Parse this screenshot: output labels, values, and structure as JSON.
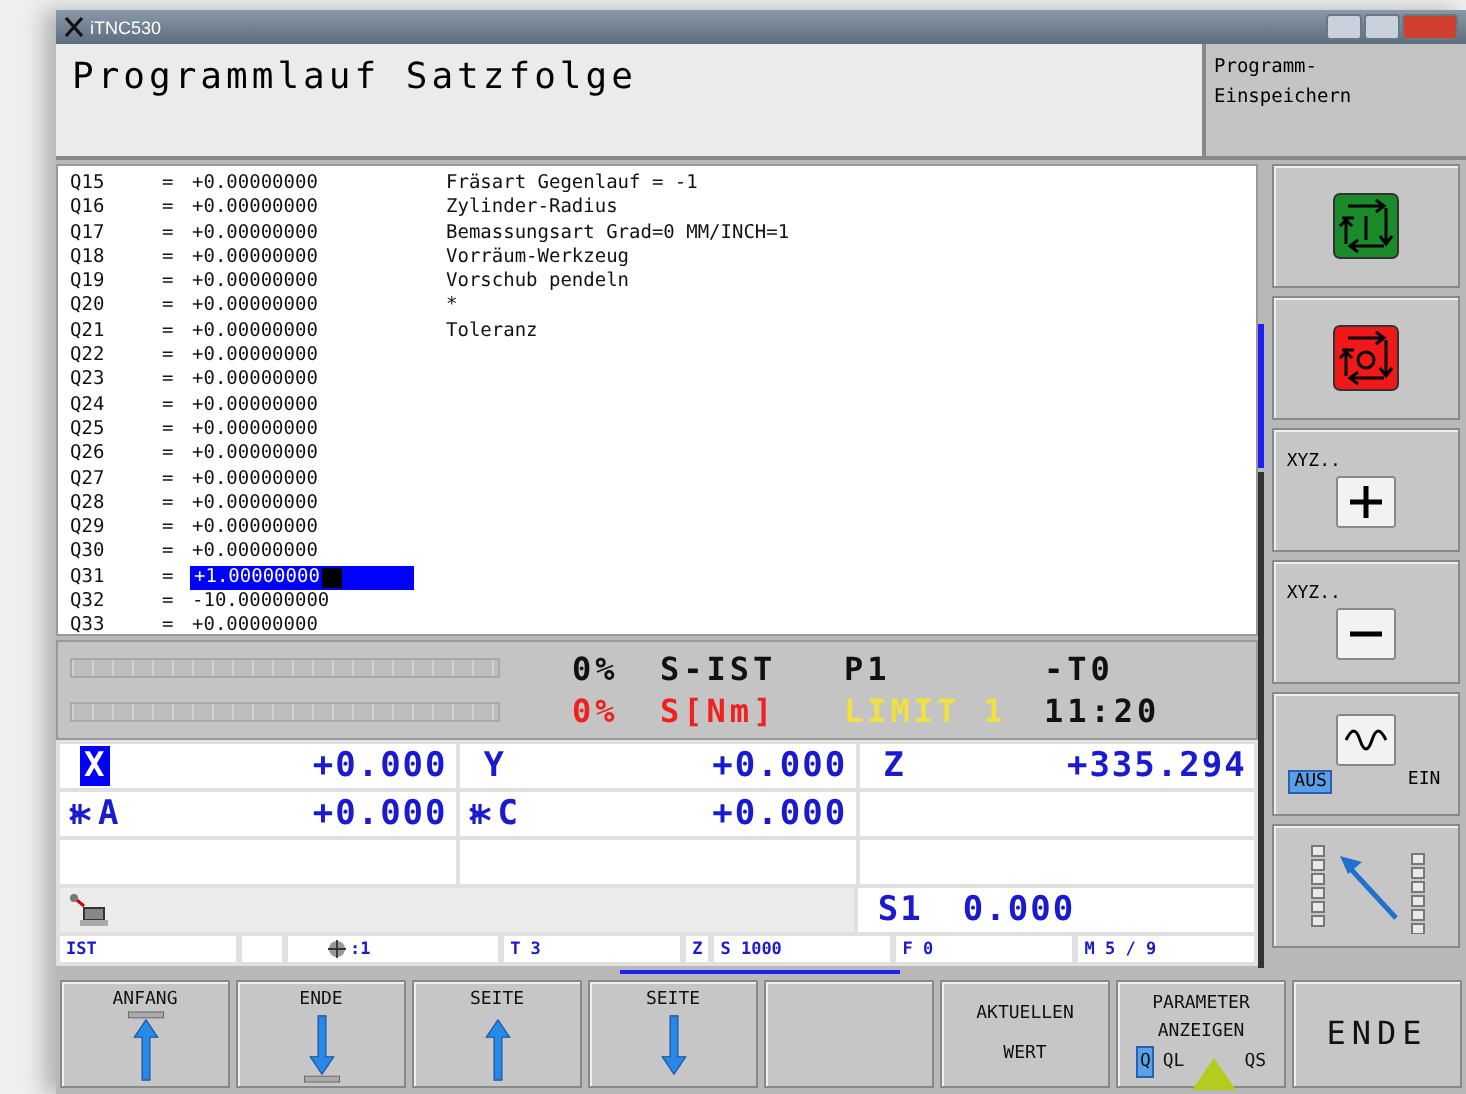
{
  "window": {
    "title": "iTNC530"
  },
  "header": {
    "title": "Programmlauf Satzfolge",
    "side_lines": [
      "Programm-",
      "Einspeichern"
    ]
  },
  "parameters": [
    {
      "name": "Q15",
      "sign": "=",
      "value": "+0.00000000",
      "comment": "Fräsart  Gegenlauf = -1",
      "selected": false
    },
    {
      "name": "Q16",
      "sign": "=",
      "value": "+0.00000000",
      "comment": "Zylinder-Radius",
      "selected": false
    },
    {
      "name": "Q17",
      "sign": "=",
      "value": "+0.00000000",
      "comment": "Bemassungsart  Grad=0 MM/INCH=1",
      "selected": false
    },
    {
      "name": "Q18",
      "sign": "=",
      "value": "+0.00000000",
      "comment": "Vorräum-Werkzeug",
      "selected": false
    },
    {
      "name": "Q19",
      "sign": "=",
      "value": "+0.00000000",
      "comment": "Vorschub pendeln",
      "selected": false
    },
    {
      "name": "Q20",
      "sign": "=",
      "value": "+0.00000000",
      "comment": "*",
      "selected": false
    },
    {
      "name": "Q21",
      "sign": "=",
      "value": "+0.00000000",
      "comment": "Toleranz",
      "selected": false
    },
    {
      "name": "Q22",
      "sign": "=",
      "value": "+0.00000000",
      "selected": false
    },
    {
      "name": "Q23",
      "sign": "=",
      "value": "+0.00000000",
      "selected": false
    },
    {
      "name": "Q24",
      "sign": "=",
      "value": "+0.00000000",
      "selected": false
    },
    {
      "name": "Q25",
      "sign": "=",
      "value": "+0.00000000",
      "selected": false
    },
    {
      "name": "Q26",
      "sign": "=",
      "value": "+0.00000000",
      "selected": false
    },
    {
      "name": "Q27",
      "sign": "=",
      "value": "+0.00000000",
      "selected": false
    },
    {
      "name": "Q28",
      "sign": "=",
      "value": "+0.00000000",
      "selected": false
    },
    {
      "name": "Q29",
      "sign": "=",
      "value": "+0.00000000",
      "selected": false
    },
    {
      "name": "Q30",
      "sign": "=",
      "value": "+0.00000000",
      "selected": false
    },
    {
      "name": "Q31",
      "sign": "=",
      "value": "+1.00000000",
      "selected": true
    },
    {
      "name": "Q32",
      "sign": "=",
      "value": "-10.00000000",
      "selected": false
    },
    {
      "name": "Q33",
      "sign": "=",
      "value": "+0.00000000",
      "selected": false
    }
  ],
  "status": {
    "lines": [
      [
        {
          "text": "0%",
          "kind": "normal"
        },
        {
          "text": "S-IST",
          "kind": "normal"
        },
        {
          "text": "P1",
          "kind": "normal"
        },
        {
          "text": "-T0",
          "kind": "normal"
        }
      ],
      [
        {
          "text": "0%",
          "kind": "alarm"
        },
        {
          "text": "S[Nm]",
          "kind": "alarm"
        },
        {
          "text": "LIMIT 1",
          "kind": "limit"
        },
        {
          "text": "11:20",
          "kind": "normal"
        }
      ]
    ]
  },
  "positions": [
    [
      {
        "clamp": false,
        "axis": "X",
        "value": "+0.000",
        "selected": true
      },
      {
        "clamp": false,
        "axis": "Y",
        "value": "+0.000",
        "selected": false
      },
      {
        "clamp": false,
        "axis": "Z",
        "value": "+335.294",
        "selected": false
      }
    ],
    [
      {
        "clamp": true,
        "axis": "A",
        "value": "+0.000",
        "selected": false
      },
      {
        "clamp": true,
        "axis": "C",
        "value": "+0.000",
        "selected": false
      }
    ]
  ],
  "spindle": {
    "label": "S1",
    "value": "0.000"
  },
  "status_bar": [
    {
      "kind": "text",
      "text": "IST"
    },
    {
      "kind": "blank"
    },
    {
      "kind": "datum",
      "text": ":1"
    },
    {
      "kind": "text",
      "text": "T 3"
    },
    {
      "kind": "small",
      "text": "Z"
    },
    {
      "kind": "text",
      "text": "S 1000"
    },
    {
      "kind": "text",
      "text": "F 0"
    },
    {
      "kind": "text",
      "text": "M 5 / 9"
    }
  ],
  "side_keys": [
    {
      "kind": "green-cycle"
    },
    {
      "kind": "red-cycle"
    },
    {
      "kind": "plus",
      "label": "XYZ.."
    },
    {
      "kind": "minus",
      "label": "XYZ.."
    },
    {
      "kind": "toggle",
      "options": [
        {
          "label": "AUS",
          "selected": true
        },
        {
          "label": "EIN",
          "selected": false
        }
      ]
    },
    {
      "kind": "arrow"
    }
  ],
  "soft_keys": [
    {
      "kind": "first",
      "lines": [
        "ANFANG"
      ]
    },
    {
      "kind": "last",
      "lines": [
        "ENDE"
      ]
    },
    {
      "kind": "page-up",
      "lines": [
        "SEITE"
      ]
    },
    {
      "kind": "page-down",
      "lines": [
        "SEITE"
      ]
    },
    {
      "kind": "empty"
    },
    {
      "kind": "text",
      "lines": [
        "AKTUELLEN",
        "WERT"
      ]
    },
    {
      "kind": "param",
      "lines": [
        "PARAMETER",
        "ANZEIGEN"
      ],
      "options": [
        {
          "label": "Q",
          "selected": true
        },
        {
          "label": "QL",
          "selected": false
        },
        {
          "label": "QS",
          "selected": false
        }
      ]
    },
    {
      "kind": "big",
      "lines": [
        "ENDE"
      ]
    }
  ]
}
